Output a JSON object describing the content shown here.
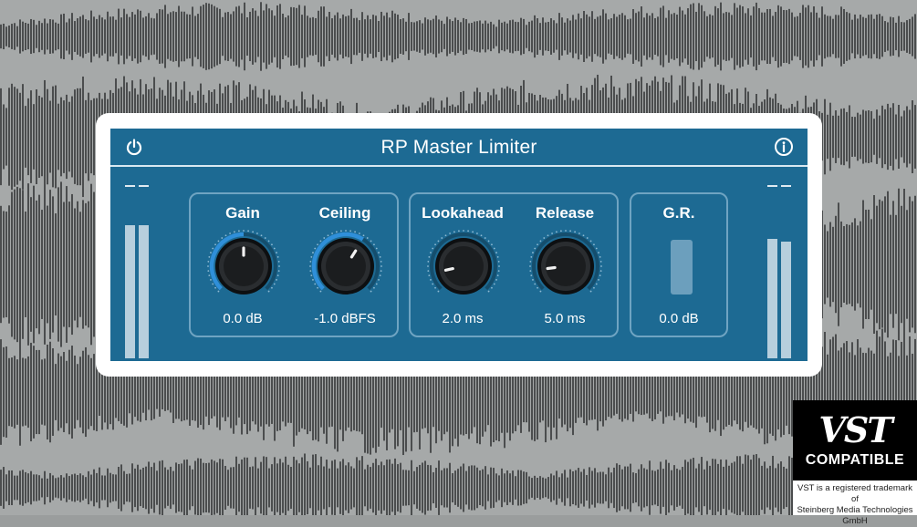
{
  "plugin": {
    "title": "RP Master Limiter",
    "accent": "#1d6a93",
    "knob_arc_color": "#2f8fd9"
  },
  "header": {
    "power_icon": "power-icon",
    "info_icon": "info-icon"
  },
  "meters": {
    "input": {
      "left_level": 0.87,
      "right_level": 0.87
    },
    "output": {
      "left_level": 0.78,
      "right_level": 0.76
    }
  },
  "controls": {
    "gain": {
      "label": "Gain",
      "value": "0.0 dB",
      "position": 0.5,
      "arc": true
    },
    "ceiling": {
      "label": "Ceiling",
      "value": "-1.0 dBFS",
      "position": 0.62,
      "arc": true
    },
    "lookahead": {
      "label": "Lookahead",
      "value": "2.0 ms",
      "position": 0.12,
      "arc": false
    },
    "release": {
      "label": "Release",
      "value": "5.0 ms",
      "position": 0.14,
      "arc": false
    }
  },
  "gain_reduction": {
    "label": "G.R.",
    "value": "0.0 dB"
  },
  "badge": {
    "logo": "VST",
    "compat": "COMPATIBLE",
    "trademark_line1": "VST is a registered trademark of",
    "trademark_line2": "Steinberg Media Technologies GmbH"
  }
}
